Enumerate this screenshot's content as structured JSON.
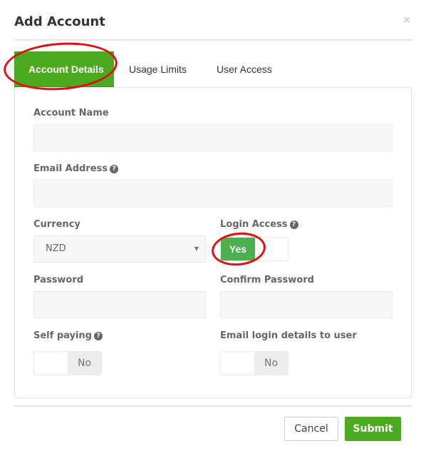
{
  "modal": {
    "title": "Add Account",
    "close_icon": "×"
  },
  "tabs": [
    {
      "label": "Account Details",
      "active": true
    },
    {
      "label": "Usage Limits",
      "active": false
    },
    {
      "label": "User Access",
      "active": false
    }
  ],
  "form": {
    "account_name": {
      "label": "Account Name",
      "value": ""
    },
    "email_address": {
      "label": "Email Address",
      "help_icon": "?",
      "value": ""
    },
    "currency": {
      "label": "Currency",
      "value": "NZD",
      "caret": "▼"
    },
    "login_access": {
      "label": "Login Access",
      "help_icon": "?",
      "value": "Yes",
      "state": "on"
    },
    "password": {
      "label": "Password",
      "value": ""
    },
    "confirm_password": {
      "label": "Confirm Password",
      "value": ""
    },
    "self_paying": {
      "label": "Self paying",
      "help_icon": "?",
      "value": "No",
      "state": "off"
    },
    "email_login_details": {
      "label": "Email login details to user",
      "value": "No",
      "state": "off"
    }
  },
  "footer": {
    "cancel_label": "Cancel",
    "submit_label": "Submit"
  },
  "colors": {
    "accent": "#4caa20",
    "toggle_on": "#4caf50",
    "annotation": "#e01010"
  }
}
